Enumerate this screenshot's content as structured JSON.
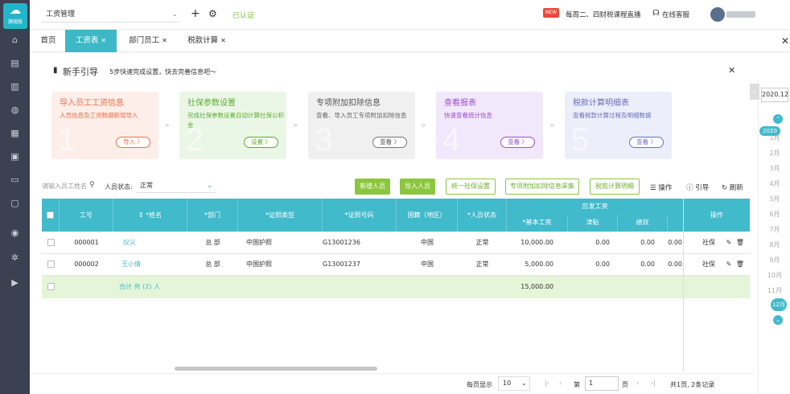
{
  "sidebar": {
    "logo_text": "旗舰版",
    "icons": [
      "home-icon",
      "document-icon",
      "chart-icon",
      "money-bag-icon",
      "ledger-icon",
      "invoice-icon",
      "archive-icon",
      "report-icon",
      "user-group-icon",
      "settings-icon",
      "play-icon"
    ]
  },
  "topbar": {
    "company": "工资管理",
    "certified": "已认证",
    "new_badge": "NEW",
    "live": "每周二、四财税课程直播",
    "service": "在线客服"
  },
  "tabs": [
    {
      "label": "首页"
    },
    {
      "label": "工资表"
    },
    {
      "label": "部门员工"
    },
    {
      "label": "税款计算"
    }
  ],
  "guide": {
    "title": "新手引导",
    "subtitle": "5步快速完成设置，快去完善信息吧～",
    "cards": [
      {
        "num": "1",
        "title": "导入员工工资信息",
        "desc": "人员信息及工资数据新增导入",
        "btn": "导入 〉"
      },
      {
        "num": "2",
        "title": "社保参数设置",
        "desc": "完成社保参数设置自动计算社保公积金",
        "btn": "设置 〉"
      },
      {
        "num": "3",
        "title": "专项附加扣除信息",
        "desc": "查看、导入员工专项附加扣除信息",
        "btn": "查看 〉"
      },
      {
        "num": "4",
        "title": "查看报表",
        "desc": "快速查看统计信息",
        "btn": "查看 〉"
      },
      {
        "num": "5",
        "title": "税款计算明细表",
        "desc": "查看税款计算过程及明细数据",
        "btn": "查看 〉"
      }
    ],
    "arrow": "»"
  },
  "toolbar": {
    "search_placeholder": "请输入员工姓名",
    "status_label": "人员状态:",
    "status_value": "正常",
    "buttons": [
      "新增人员",
      "导入人员",
      "统一社保设置",
      "专项附加扣除信息采集",
      "税款计算明细"
    ],
    "ops": "操作",
    "guide": "引导",
    "refresh": "刷新"
  },
  "table": {
    "headers": {
      "id": "工号",
      "name": "*姓名",
      "dept": "*部门",
      "idtype": "*证照类型",
      "idno": "*证照号码",
      "nation": "国籍（地区）",
      "status": "*人员状态",
      "salary_group": "应发工资",
      "base": "*基本工资",
      "allowance": "津贴",
      "bonus": "绩效",
      "ops": "操作"
    },
    "rows": [
      {
        "id": "000001",
        "name": "仪义",
        "dept": "总 部",
        "idtype": "中国护照",
        "idno": "G13001236",
        "nation": "中国",
        "status": "正常",
        "base": "10,000.00",
        "allowance": "0.00",
        "bonus": "0.00",
        "extra": "0.00",
        "ops": "社保"
      },
      {
        "id": "000002",
        "name": "王小倩",
        "dept": "总 部",
        "idtype": "中国护照",
        "idno": "G13001237",
        "nation": "中国",
        "status": "正常",
        "base": "5,000.00",
        "allowance": "0.00",
        "bonus": "0.00",
        "extra": "0.00",
        "ops": "社保"
      }
    ],
    "summary": {
      "label": "合计 共 (2) 人",
      "base": "15,000.00"
    }
  },
  "pager": {
    "per_page_label": "每页显示",
    "per_page": "10",
    "page_prefix": "第",
    "page": "1",
    "page_suffix": "页",
    "total": "共1页, 2条记录"
  },
  "months": {
    "year_box": "2020.12",
    "year_badge": "2020",
    "list": [
      "1月",
      "2月",
      "3月",
      "4月",
      "5月",
      "6月",
      "7月",
      "8月",
      "9月",
      "10月",
      "11月"
    ],
    "current": "12月"
  }
}
